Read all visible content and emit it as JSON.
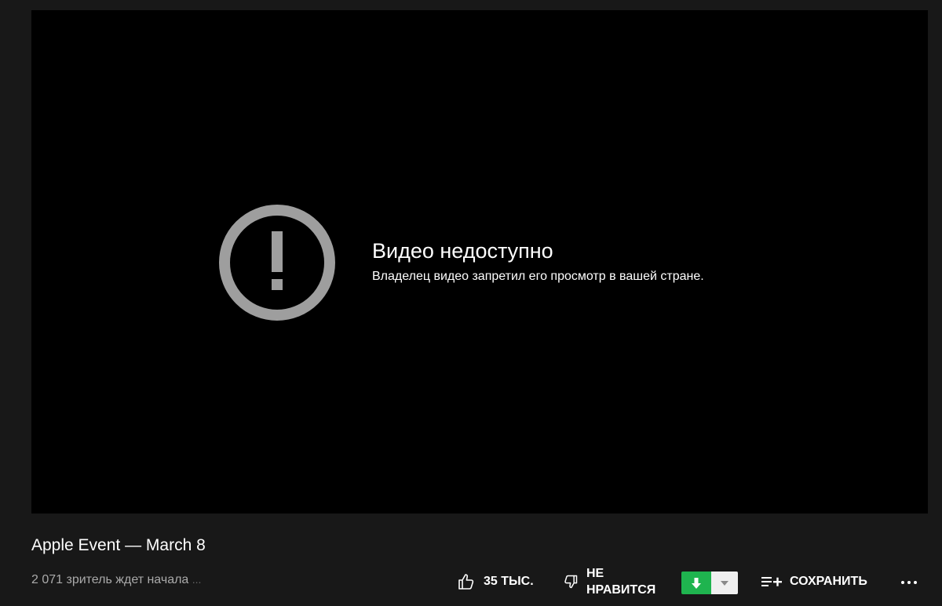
{
  "player": {
    "error_title": "Видео недоступно",
    "error_message": "Владелец видео запретил его просмотр в вашей стране.",
    "error_icon": "alert-circle-icon",
    "error_icon_color": "#9e9e9e"
  },
  "video": {
    "title": "Apple Event — March 8",
    "viewers": "2 071 зритель ждет начала",
    "viewers_ellipsis": "..."
  },
  "actions": {
    "like_count": "35 ТЫС.",
    "dislike_label_line1": "НЕ",
    "dislike_label_line2": "НРАВИТСЯ",
    "save_label": "СОХРАНИТЬ",
    "download_color": "#1fb44f"
  }
}
